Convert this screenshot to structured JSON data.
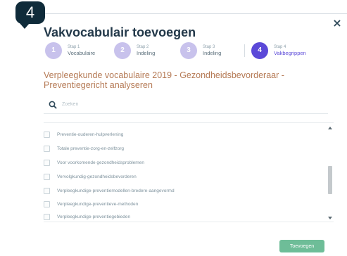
{
  "badge": {
    "number": "4"
  },
  "modal": {
    "title": "Vakvocabulair toevoegen",
    "close_symbol": "×"
  },
  "stepper": {
    "steps": [
      {
        "number": "1",
        "kicker": "Stap 1",
        "label": "Vocabulaire",
        "active": false
      },
      {
        "number": "2",
        "kicker": "Stap 2",
        "label": "Indeling",
        "active": false
      },
      {
        "number": "3",
        "kicker": "Stap 3",
        "label": "Indeling",
        "active": false
      },
      {
        "number": "4",
        "kicker": "Stap 4",
        "label": "Vakbegrippen",
        "active": true
      }
    ]
  },
  "section": {
    "title": "Verpleegkunde vocabulaire 2019 - Gezondheidsbevorderaar - Preventiegericht analyseren"
  },
  "search": {
    "placeholder": "Zoeken",
    "value": ""
  },
  "list": {
    "items": [
      {
        "label": "Preventie-ouderen-hulpverlening"
      },
      {
        "label": "Totale preventie-zorg-en-zelfzorg"
      },
      {
        "label": "Voor voorkomende gezondheidsproblemen"
      },
      {
        "label": "Vervolgkundig-gezondheidsbevorderen"
      },
      {
        "label": "Verpleegkundige-preventiemodellen-bredere-aangevormd"
      },
      {
        "label": "Verpleegkundige-preventieve-methoden"
      },
      {
        "label": "Verpleegkundige-preventiegebieden"
      }
    ]
  },
  "footer": {
    "add_button_label": "Toevoegen"
  },
  "colors": {
    "badge_bg": "#0f2b3a",
    "step_active": "#5b49d8",
    "step_inactive": "#c8c2ec",
    "section_title": "#b57a55",
    "add_button": "#6ebd98"
  }
}
